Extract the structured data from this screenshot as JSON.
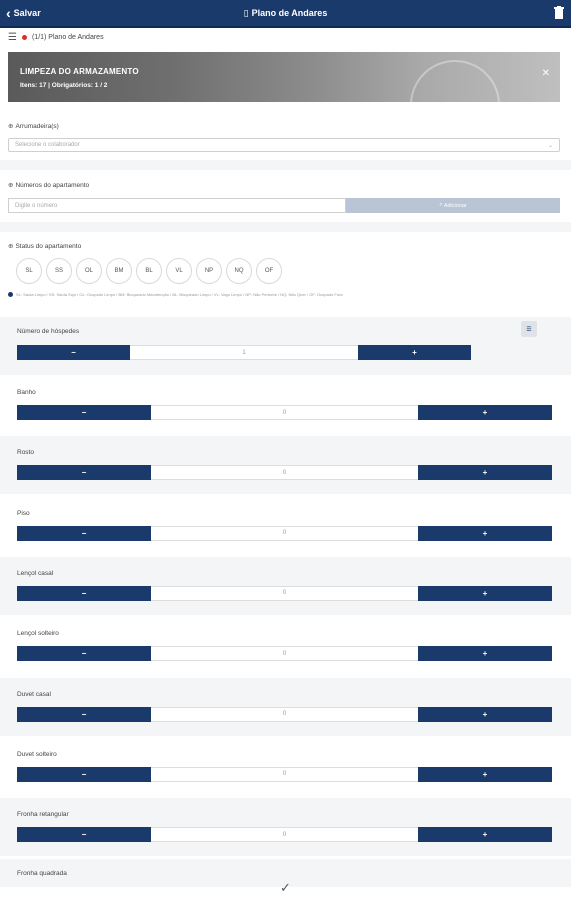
{
  "topbar": {
    "back_label": "Salvar",
    "title": "Plano de Andares"
  },
  "crumb": {
    "text": "(1/1) Plano de Andares"
  },
  "banner": {
    "title": "LIMPEZA DO ARMAZAMENTO",
    "subtitle": "Itens: 17 | Obrigatórios: 1 / 2"
  },
  "camareira": {
    "label": "Arrumadeira(s)",
    "placeholder": "Selecione o colaborador"
  },
  "apartment": {
    "label": "Números do apartamento",
    "placeholder": "Digite o número",
    "button": "Adicionar"
  },
  "status": {
    "label": "Status do apartamento",
    "options": [
      "SL",
      "SS",
      "OL",
      "BM",
      "BL",
      "VL",
      "NP",
      "NQ",
      "OF"
    ],
    "legend": "SL: Saída Limpo / SS: Saída Sujo / OL: Ocupado Limpo / BM: Bloqueado Manutenção / BL: Bloqueado Limpo / VL: Vago Limpo / NP: Não Perturbe / NQ: Não Quer / OF: Ocupado Fora"
  },
  "guests": {
    "label": "Número de hóspedes",
    "value": "1",
    "minus": "−",
    "plus": "+"
  },
  "items": [
    {
      "label": "Banho",
      "value": "0"
    },
    {
      "label": "Rosto",
      "value": "0"
    },
    {
      "label": "Piso",
      "value": "0"
    },
    {
      "label": "Lençol casal",
      "value": "0"
    },
    {
      "label": "Lençol solteiro",
      "value": "0"
    },
    {
      "label": "Duvet casal",
      "value": "0"
    },
    {
      "label": "Duvet solteiro",
      "value": "0"
    },
    {
      "label": "Fronha retangular",
      "value": "0"
    }
  ],
  "last_item": {
    "label": "Fronha quadrada"
  },
  "controls": {
    "minus": "−",
    "plus": "+"
  },
  "colors": {
    "primary": "#1a3a6b",
    "band": "#f4f5f7",
    "accent_red": "#d9302a"
  },
  "icons": {
    "back": "chevron-left-icon",
    "doc": "document-icon",
    "trash": "trash-icon",
    "close": "close-icon",
    "menu": "list-icon",
    "confirm": "check-icon"
  }
}
